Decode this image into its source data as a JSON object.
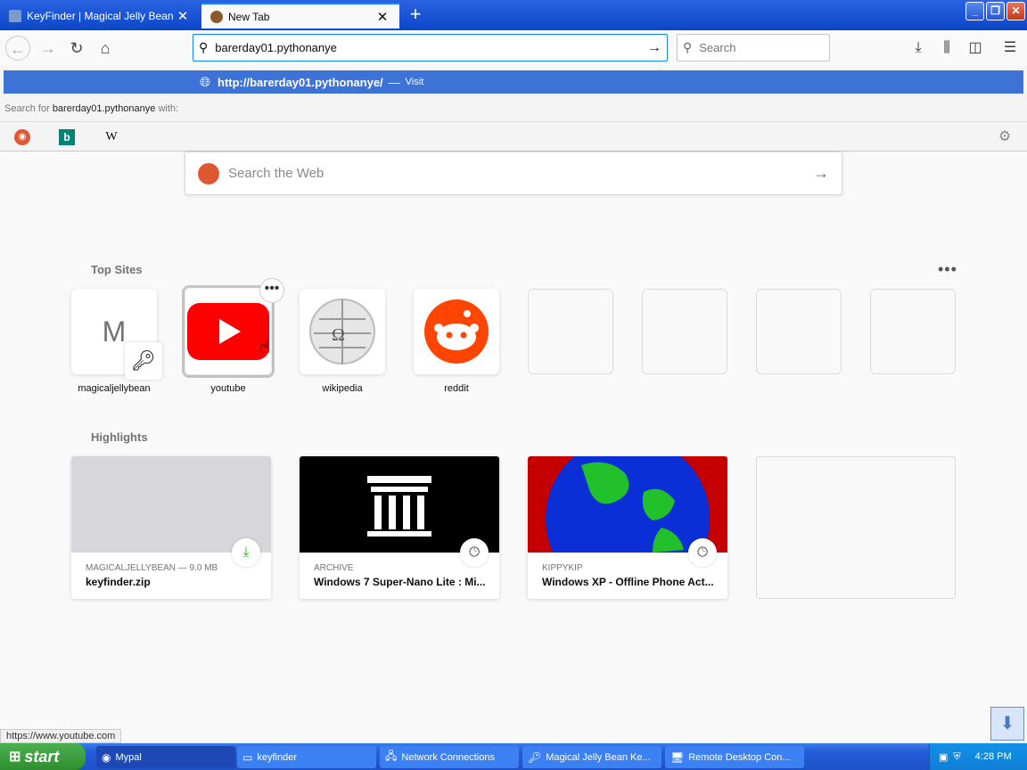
{
  "tabs": [
    {
      "label": "KeyFinder | Magical Jelly Bean",
      "active": false
    },
    {
      "label": "New Tab",
      "active": true
    }
  ],
  "navbar": {
    "url_value": "barerday01.pythonanye",
    "search_placeholder": "Search"
  },
  "popup": {
    "suggestion_url": "http://barerday01.pythonanye/",
    "suggestion_sep": "—",
    "suggestion_action": "Visit",
    "search_for_prefix": "Search for",
    "search_for_term": "barerday01.pythonanye",
    "search_for_suffix": "with:"
  },
  "content": {
    "search_placeholder": "Search the Web",
    "top_sites_title": "Top Sites",
    "highlights_title": "Highlights",
    "top_sites": [
      {
        "label": "magicaljellybean",
        "letter": "M"
      },
      {
        "label": "youtube"
      },
      {
        "label": "wikipedia"
      },
      {
        "label": "reddit"
      }
    ],
    "highlights": [
      {
        "context": "MAGICALJELLYBEAN — 9.0 MB",
        "title": "keyfinder.zip"
      },
      {
        "context": "ARCHIVE",
        "title": "Windows 7 Super-Nano Lite : Mi..."
      },
      {
        "context": "KIPPYKIP",
        "title": "Windows XP - Offline Phone Act..."
      }
    ]
  },
  "status_link": "https://www.youtube.com",
  "taskbar": {
    "start_label": "start",
    "tasks": [
      "Mypal",
      "keyfinder",
      "Network Connections",
      "Magical Jelly Bean Ke...",
      "Remote Desktop Con..."
    ],
    "clock": "4:28 PM"
  },
  "colors": {
    "accent": "#0a84ff",
    "titlebar": "#0c47c9",
    "suggestion_highlight": "#3d72d7",
    "youtube_red": "#ff0000",
    "reddit_orange": "#ff4500"
  }
}
